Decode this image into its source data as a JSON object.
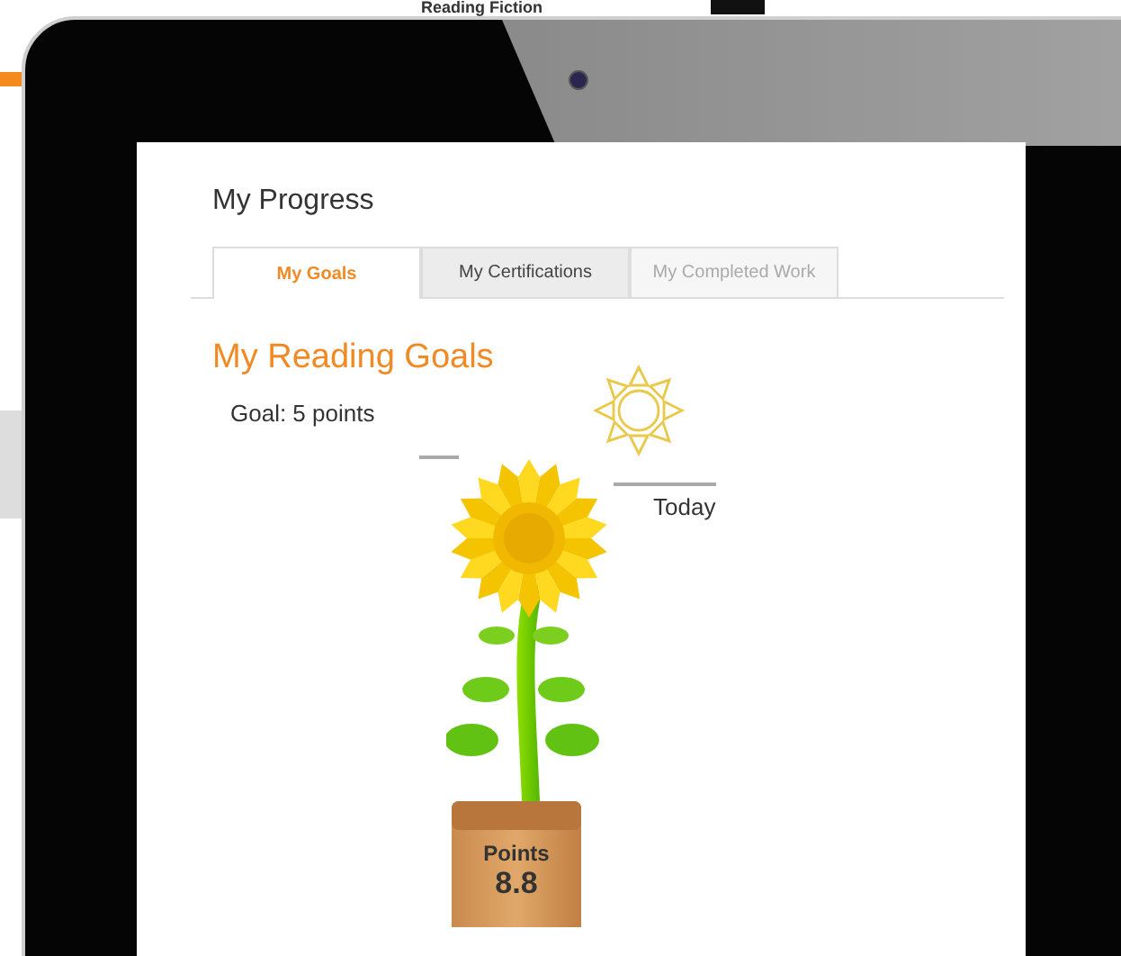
{
  "background_page": {
    "heading": "Reading Fiction"
  },
  "page_title": "My Progress",
  "tabs": [
    {
      "label": "My Goals",
      "selected": true,
      "disabled": false
    },
    {
      "label": "My Certifications",
      "selected": false,
      "disabled": false
    },
    {
      "label": "My Completed Work",
      "selected": false,
      "disabled": true
    }
  ],
  "section_title": "My Reading Goals",
  "goal": "Goal: 5 points",
  "today_label": "Today",
  "pot": {
    "label": "Points",
    "value": "8.8"
  }
}
